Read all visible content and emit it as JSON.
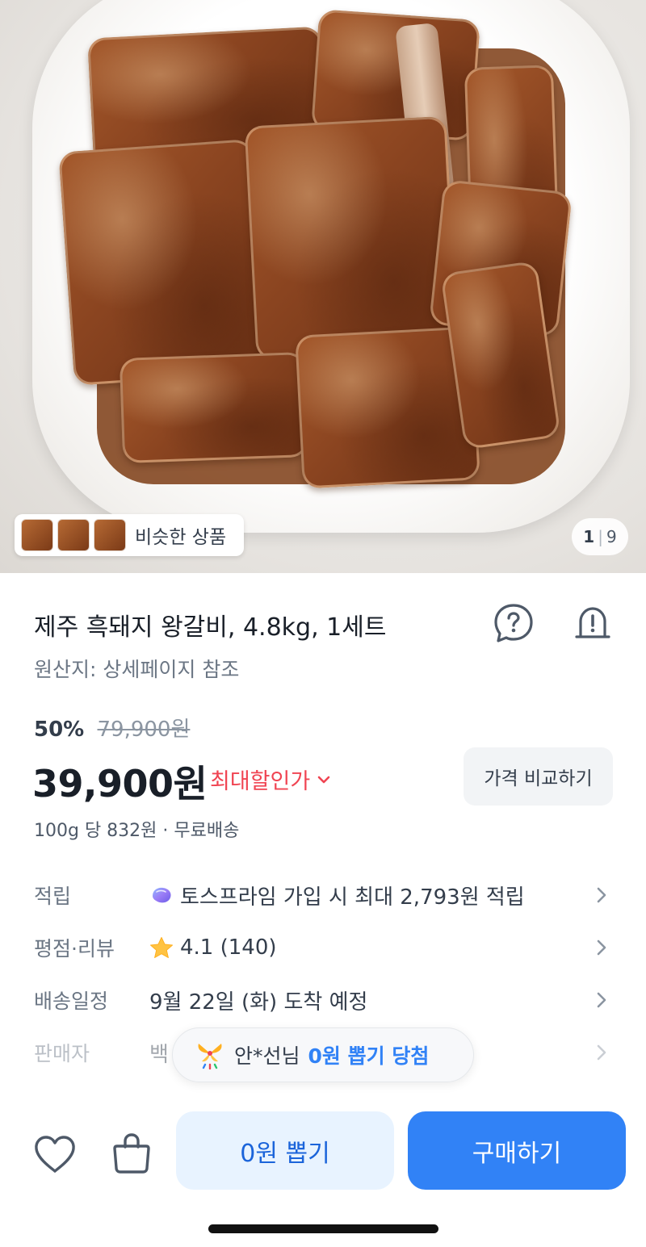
{
  "hero": {
    "image_alt": "marinated pork ribs on a white plate",
    "similar_label": "비슷한 상품",
    "page_current": "1",
    "page_total": "9"
  },
  "product": {
    "title": "제주 흑돼지 왕갈비, 4.8kg, 1세트",
    "origin": "원산지: 상세페이지 참조",
    "discount_rate": "50%",
    "original_price": "79,900원",
    "price": "39,900원",
    "max_discount_label": "최대할인가",
    "compare_button": "가격 비교하기",
    "unit_price": "100g 당 832원 · 무료배송"
  },
  "info_rows": [
    {
      "label": "적립",
      "value": "토스프라임 가입 시 최대 2,793원 적립",
      "icon": "prime-gem-icon"
    },
    {
      "label": "평점·리뷰",
      "value": "4.1 (140)",
      "icon": "star-icon"
    },
    {
      "label": "배송일정",
      "value": "9월 22일 (화) 도착 예정",
      "icon": ""
    },
    {
      "label": "판매자",
      "value": "백",
      "icon": ""
    }
  ],
  "toast": {
    "user": "안*선님",
    "message": "0원 뽑기 당첨"
  },
  "bottom_bar": {
    "draw_button": "0원 뽑기",
    "buy_button": "구매하기"
  },
  "colors": {
    "accent_blue": "#3182f6",
    "discount_red": "#f04452",
    "light_blue_bg": "#e8f3ff"
  }
}
